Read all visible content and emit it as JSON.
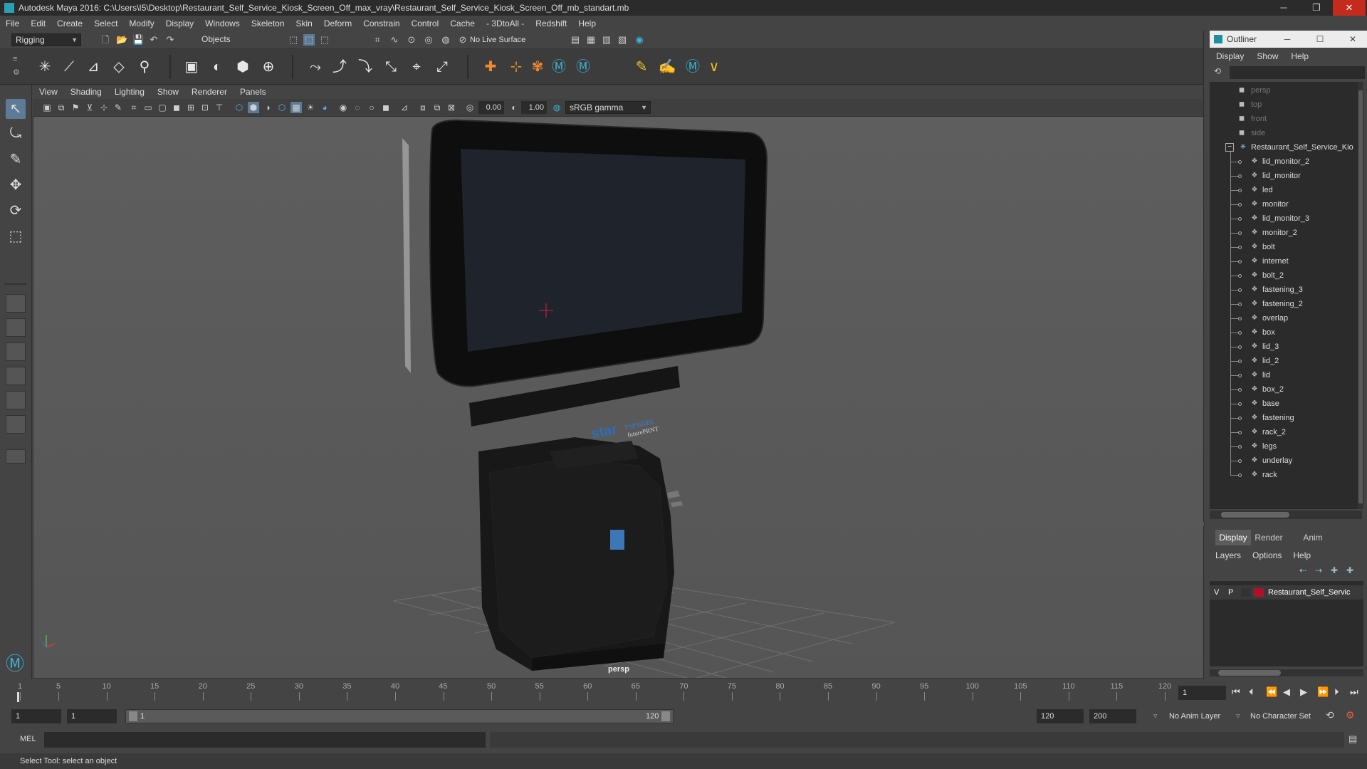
{
  "window": {
    "title": "Autodesk Maya 2016: C:\\Users\\I5\\Desktop\\Restaurant_Self_Service_Kiosk_Screen_Off_max_vray\\Restaurant_Self_Service_Kiosk_Screen_Off_mb_standart.mb",
    "min": "─",
    "max": "❐",
    "close": "✕"
  },
  "menubar": [
    "File",
    "Edit",
    "Create",
    "Select",
    "Modify",
    "Display",
    "Windows",
    "Skeleton",
    "Skin",
    "Deform",
    "Constrain",
    "Control",
    "Cache",
    "- 3DtoAll -",
    "Redshift",
    "Help"
  ],
  "statusline": {
    "mode": "Rigging",
    "selection_mode": "Objects",
    "live_surface": "No Live Surface"
  },
  "viewport": {
    "menu": [
      "View",
      "Shading",
      "Lighting",
      "Show",
      "Renderer",
      "Panels"
    ],
    "exposure": "0.00",
    "gamma": "1.00",
    "color_space": "sRGB gamma",
    "camera": "persp",
    "printer_brand": "star",
    "printer_model": "TSP100III",
    "printer_sub": "futurePRNT"
  },
  "timeline": {
    "ticks": [
      "1",
      "5",
      "10",
      "15",
      "20",
      "25",
      "30",
      "35",
      "40",
      "45",
      "50",
      "55",
      "60",
      "65",
      "70",
      "75",
      "80",
      "85",
      "90",
      "95",
      "100",
      "105",
      "110",
      "115",
      "120"
    ],
    "current_frame": "1"
  },
  "range": {
    "start": "1",
    "playback_start": "1",
    "slider_start": "1",
    "slider_end": "120",
    "playback_end": "120",
    "end": "200",
    "anim_layer": "No Anim Layer",
    "character_set": "No Character Set"
  },
  "cmdline": {
    "label": "MEL"
  },
  "helpline": "Select Tool: select an object",
  "outliner": {
    "title": "Outliner",
    "menu": [
      "Display",
      "Show",
      "Help"
    ],
    "cameras": [
      "persp",
      "top",
      "front",
      "side"
    ],
    "root": "Restaurant_Self_Service_Kio",
    "children": [
      "lid_monitor_2",
      "lid_monitor",
      "led",
      "monitor",
      "lid_monitor_3",
      "monitor_2",
      "bolt",
      "internet",
      "bolt_2",
      "fastening_3",
      "fastening_2",
      "overlap",
      "box",
      "lid_3",
      "lid_2",
      "lid",
      "box_2",
      "base",
      "fastening",
      "rack_2",
      "legs",
      "underlay",
      "rack"
    ]
  },
  "layer_editor": {
    "tabs": [
      "Display",
      "Render",
      "Anim"
    ],
    "menu": [
      "Layers",
      "Options",
      "Help"
    ],
    "layer": {
      "v": "V",
      "p": "P",
      "name": "Restaurant_Self_Servic",
      "color": "#b0102a"
    }
  }
}
